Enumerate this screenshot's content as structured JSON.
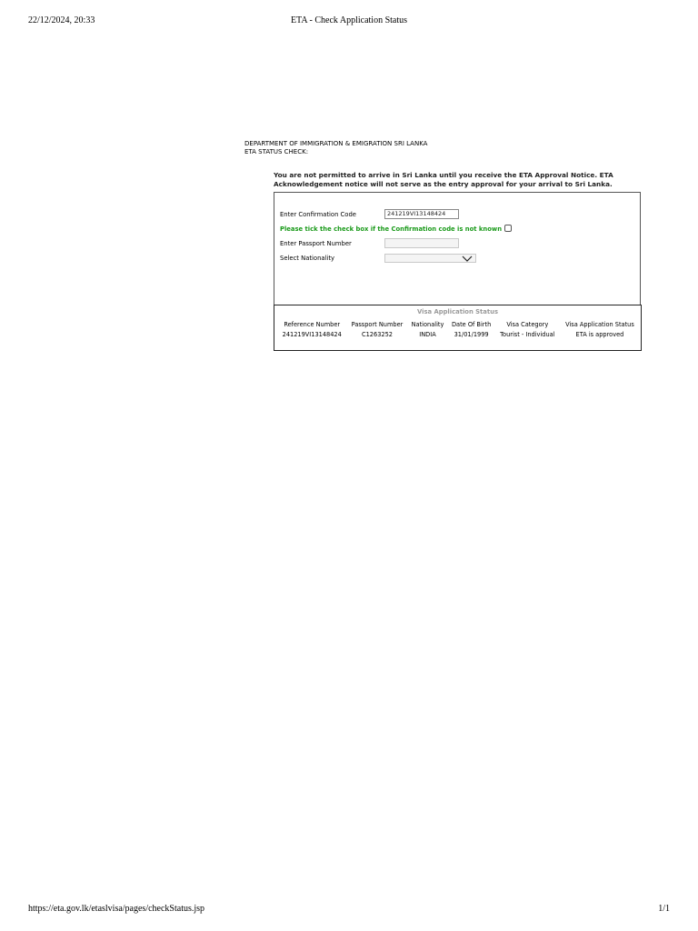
{
  "print_header": {
    "datetime": "22/12/2024, 20:33",
    "title": "ETA - Check Application Status"
  },
  "print_footer": {
    "url": "https://eta.gov.lk/etaslvisa/pages/checkStatus.jsp",
    "page": "1/1"
  },
  "header": {
    "department": "DEPARTMENT OF IMMIGRATION & EMIGRATION SRI LANKA",
    "subtitle": "ETA STATUS CHECK:"
  },
  "notice": "You are not permitted to arrive in Sri Lanka until you receive the ETA Approval Notice. ETA Acknowledgement notice will not serve as the entry approval for your arrival to Sri Lanka.",
  "form": {
    "confirmation_label": "Enter Confirmation Code",
    "confirmation_value": "241219VI13148424",
    "checkbox_label": "Please tick the check box if the Confirmation code is not known",
    "passport_label": "Enter Passport Number",
    "passport_value": "",
    "nationality_label": "Select Nationality",
    "nationality_value": ""
  },
  "status": {
    "title": "Visa Application Status",
    "columns": [
      "Reference Number",
      "Passport Number",
      "Nationality",
      "Date Of Birth",
      "Visa Category",
      "Visa Application Status"
    ],
    "rows": [
      [
        "241219VI13148424",
        "C1263252",
        "INDIA",
        "31/01/1999",
        "Tourist - Individual",
        "ETA is approved"
      ]
    ]
  },
  "colors": {
    "notice_green": "#1a9a1a",
    "status_title_gray": "#9a9a9a"
  }
}
